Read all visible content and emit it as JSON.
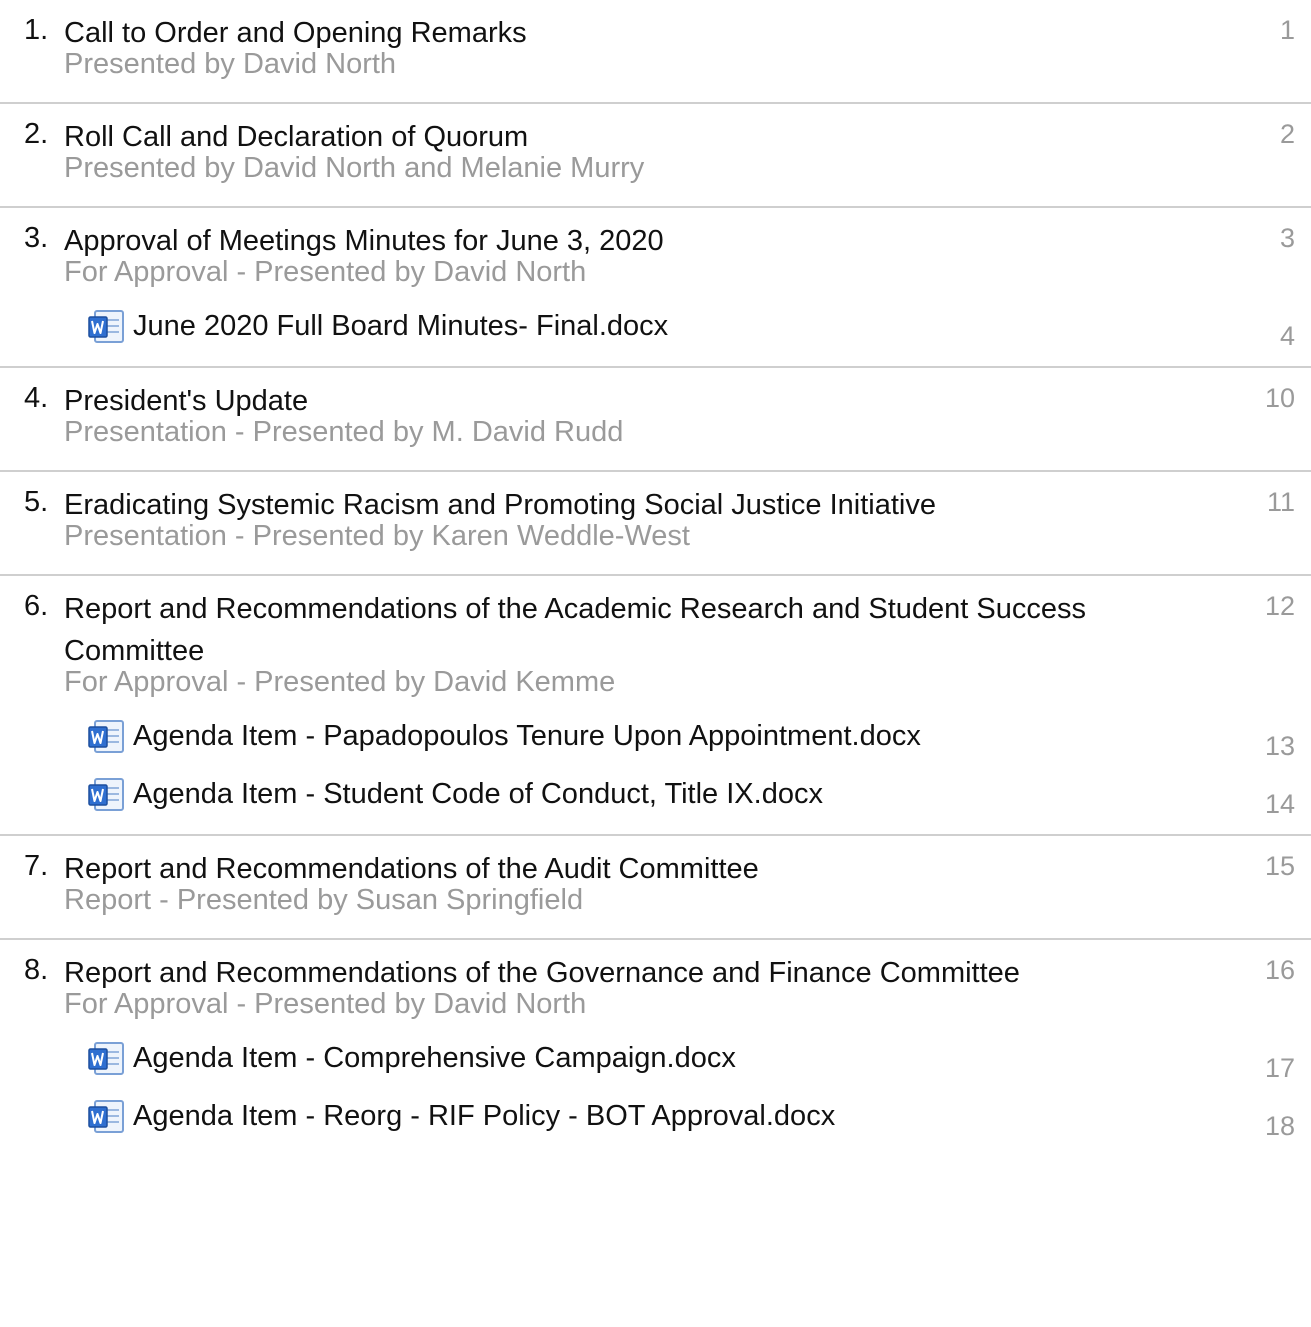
{
  "items": [
    {
      "num": "1.",
      "title": "Call to Order and Opening Remarks",
      "sub": "Presented by David North",
      "page": "1",
      "attachments": []
    },
    {
      "num": "2.",
      "title": "Roll Call and Declaration of Quorum",
      "sub": "Presented by David North and Melanie Murry",
      "page": "2",
      "attachments": []
    },
    {
      "num": "3.",
      "title": "Approval of Meetings Minutes for June 3, 2020",
      "sub": "For Approval - Presented by David North",
      "page": "3",
      "attachments": [
        {
          "name": "June 2020 Full Board Minutes- Final.docx",
          "page": "4"
        }
      ]
    },
    {
      "num": "4.",
      "title": "President's Update",
      "sub": "Presentation - Presented by M. David Rudd",
      "page": "10",
      "attachments": []
    },
    {
      "num": "5.",
      "title": "Eradicating Systemic Racism and Promoting Social Justice Initiative",
      "sub": "Presentation - Presented by Karen Weddle-West",
      "page": "11",
      "attachments": []
    },
    {
      "num": "6.",
      "title": "Report and Recommendations of the Academic Research and Student Success Committee",
      "sub": "For Approval - Presented by David Kemme",
      "page": "12",
      "attachments": [
        {
          "name": "Agenda Item - Papadopoulos Tenure Upon Appointment.docx",
          "page": "13"
        },
        {
          "name": "Agenda Item - Student Code of Conduct, Title IX.docx",
          "page": "14"
        }
      ]
    },
    {
      "num": "7.",
      "title": "Report and Recommendations of the Audit Committee",
      "sub": "Report - Presented by Susan Springfield",
      "page": "15",
      "attachments": []
    },
    {
      "num": "8.",
      "title": "Report and Recommendations of the Governance and Finance Committee",
      "sub": "For Approval - Presented by David North",
      "page": "16",
      "attachments": [
        {
          "name": "Agenda Item - Comprehensive Campaign.docx",
          "page": "17"
        },
        {
          "name": "Agenda Item - Reorg -  RIF Policy - BOT Approval.docx",
          "page": "18"
        }
      ]
    }
  ],
  "colors": {
    "text": "#111111",
    "muted": "#9a9a9a",
    "divider": "#cfcfcf",
    "icon_blue": "#2f6fd0"
  },
  "icons": {
    "attachment": "word-document-icon"
  }
}
